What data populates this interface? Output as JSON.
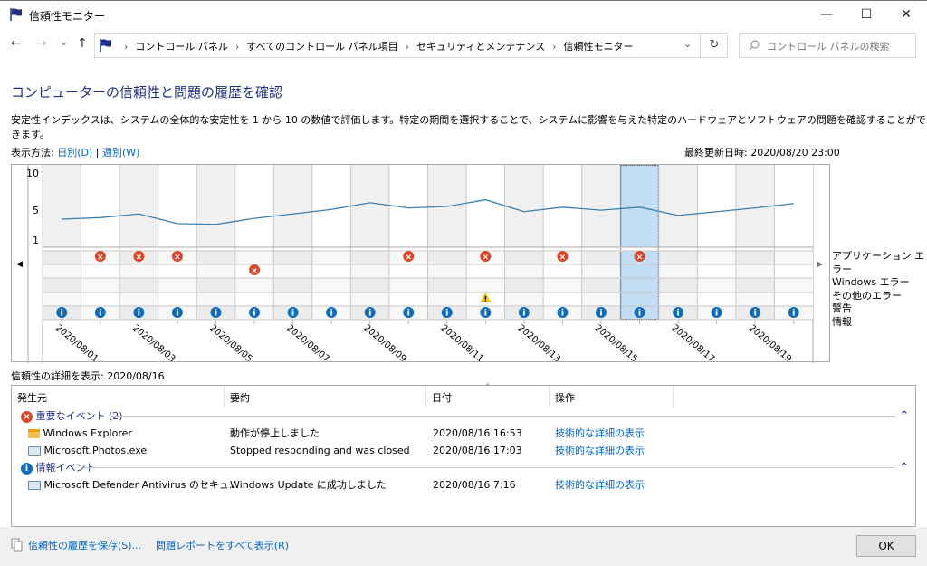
{
  "window": {
    "title": "信頼性モニター",
    "minimize": "—",
    "maximize": "☐",
    "close": "✕"
  },
  "nav": {
    "back": "←",
    "forward": "→",
    "recent": "⌄",
    "up": "↑",
    "refresh": "↻",
    "dropdown": "⌄"
  },
  "breadcrumb": [
    "コントロール パネル",
    "すべてのコントロール パネル項目",
    "セキュリティとメンテナンス",
    "信頼性モニター"
  ],
  "search": {
    "placeholder": "コントロール パネルの検索"
  },
  "heading": "コンピューターの信頼性と問題の履歴を確認",
  "description": "安定性インデックスは、システムの全体的な安定性を 1 から 10 の数値で評価します。特定の期間を選択することで、システムに影響を与えた特定のハードウェアとソフトウェアの問題を確認することができます。",
  "view": {
    "label": "表示方法:",
    "daily": "日別(D)",
    "weekly": "週別(W)",
    "sep": "|"
  },
  "last_updated": "最終更新日時: 2020/08/20 23:00",
  "chart_data": {
    "type": "line",
    "ylabel": "",
    "yticks": [
      10,
      5,
      1
    ],
    "ylim": [
      1,
      10
    ],
    "dates": [
      "2020/08/01",
      "2020/08/02",
      "2020/08/03",
      "2020/08/04",
      "2020/08/05",
      "2020/08/06",
      "2020/08/07",
      "2020/08/08",
      "2020/08/09",
      "2020/08/10",
      "2020/08/11",
      "2020/08/12",
      "2020/08/13",
      "2020/08/14",
      "2020/08/15",
      "2020/08/16",
      "2020/08/17",
      "2020/08/18",
      "2020/08/19",
      "2020/08/20"
    ],
    "xtick_labels": [
      "2020/08/01",
      "2020/08/03",
      "2020/08/05",
      "2020/08/07",
      "2020/08/09",
      "2020/08/11",
      "2020/08/13",
      "2020/08/15",
      "2020/08/17",
      "2020/08/19"
    ],
    "stability_index": [
      3.8,
      4.0,
      4.5,
      3.2,
      3.1,
      3.9,
      4.5,
      5.1,
      6.0,
      5.3,
      5.5,
      6.4,
      4.8,
      5.4,
      5.0,
      5.4,
      4.3,
      4.8,
      5.3,
      5.9
    ],
    "selected_date": "2020/08/16",
    "event_rows": [
      "アプリケーション エラー",
      "Windows エラー",
      "その他のエラー",
      "警告",
      "情報"
    ],
    "events": {
      "application_error": [
        "2020/08/02",
        "2020/08/03",
        "2020/08/04",
        "2020/08/10",
        "2020/08/12",
        "2020/08/14",
        "2020/08/16"
      ],
      "windows_error": [
        "2020/08/06"
      ],
      "other_error": [],
      "warning": [
        "2020/08/12"
      ],
      "information": "all"
    },
    "colors": {
      "line": "#3c7fb1",
      "selected": "#c3ddf5",
      "error": "#d9472b",
      "warning": "#f5c400",
      "info": "#0f6cbd"
    }
  },
  "details": {
    "label": "信頼性の詳細を表示: 2020/08/16",
    "columns": [
      "発生元",
      "要約",
      "日付",
      "操作"
    ],
    "groups": [
      {
        "title": "重要なイベント (2)",
        "icon": "error-icon",
        "rows": [
          {
            "source": "Windows Explorer",
            "summary": "動作が停止しました",
            "date": "2020/08/16 16:53",
            "action": "技術的な詳細の表示"
          },
          {
            "source": "Microsoft.Photos.exe",
            "summary": "Stopped responding and was closed",
            "date": "2020/08/16 17:03",
            "action": "技術的な詳細の表示"
          }
        ]
      },
      {
        "title": "情報イベント",
        "icon": "info-icon",
        "rows": [
          {
            "source": "Microsoft Defender Antivirus のセキュ...",
            "summary": "Windows Update に成功しました",
            "date": "2020/08/16 7:16",
            "action": "技術的な詳細の表示"
          }
        ]
      }
    ]
  },
  "footer": {
    "save": "信頼性の履歴を保存(S)...",
    "all_reports": "問題レポートをすべて表示(R)",
    "ok": "OK"
  }
}
